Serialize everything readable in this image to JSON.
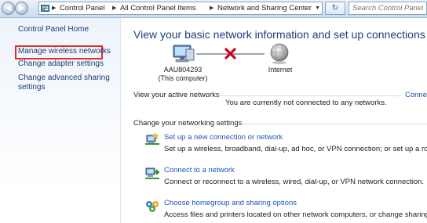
{
  "addressbar": {
    "breadcrumbs": [
      "Control Panel",
      "All Control Panel Items",
      "Network and Sharing Center"
    ],
    "search_placeholder": "Search Control Panel",
    "back_icon": "back-arrow-icon",
    "forward_icon": "forward-arrow-icon",
    "refresh_icon": "refresh-icon"
  },
  "sidebar": {
    "items": [
      {
        "label": "Control Panel Home"
      },
      {
        "label": "Manage wireless networks",
        "highlighted": true,
        "highlight_color": "#e22b2b"
      },
      {
        "label": "Change adapter settings"
      },
      {
        "label": "Change advanced sharing settings",
        "lines": [
          "Change advanced sharing",
          "settings"
        ]
      }
    ]
  },
  "main": {
    "title": "View your basic network information and set up connections",
    "network_map": {
      "computer_name": "AAU804293",
      "computer_sub": "(This computer)",
      "internet_label": "Internet",
      "link_status": "disconnected",
      "error_color": "#d0021b"
    },
    "active_networks": {
      "heading": "View your active networks",
      "status": "You are currently not connected to any networks.",
      "connect_link": "Conne"
    },
    "settings": {
      "heading": "Change your networking settings",
      "tasks": [
        {
          "title": "Set up a new connection or network",
          "description": "Set up a wireless, broadband, dial-up, ad hoc, or VPN connection; or set up a router o",
          "icon": "new-connection-icon"
        },
        {
          "title": "Connect to a network",
          "description": "Connect or reconnect to a wireless, wired, dial-up, or VPN network connection.",
          "icon": "connect-network-icon"
        },
        {
          "title": "Choose homegroup and sharing options",
          "description": "Access files and printers located on other network computers, or change sharing setti",
          "icon": "homegroup-icon"
        }
      ]
    }
  }
}
